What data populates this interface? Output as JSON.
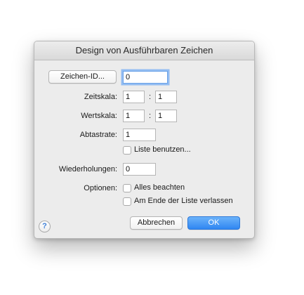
{
  "dialog": {
    "title": "Design von Ausführbaren Zeichen"
  },
  "char_id": {
    "button_label": "Zeichen-ID...",
    "value": "0"
  },
  "time_scale": {
    "label": "Zeitskala:",
    "value1": "1",
    "separator": ":",
    "value2": "1"
  },
  "value_scale": {
    "label": "Wertskala:",
    "value1": "1",
    "separator": ":",
    "value2": "1"
  },
  "sample_rate": {
    "label": "Abtastrate:",
    "value": "1"
  },
  "use_list": {
    "label": "Liste benutzen...",
    "checked": false
  },
  "repetitions": {
    "label": "Wiederholungen:",
    "value": "0"
  },
  "options": {
    "label": "Optionen:",
    "items": [
      {
        "label": "Alles beachten",
        "checked": false
      },
      {
        "label": "Am Ende der Liste verlassen",
        "checked": false
      }
    ]
  },
  "buttons": {
    "cancel": "Abbrechen",
    "ok": "OK"
  },
  "help": {
    "icon": "question-mark-icon",
    "glyph": "?"
  },
  "colors": {
    "accent": "#2f86f2",
    "focus_ring": "#93bdf2",
    "dialog_bg": "#ececec"
  }
}
